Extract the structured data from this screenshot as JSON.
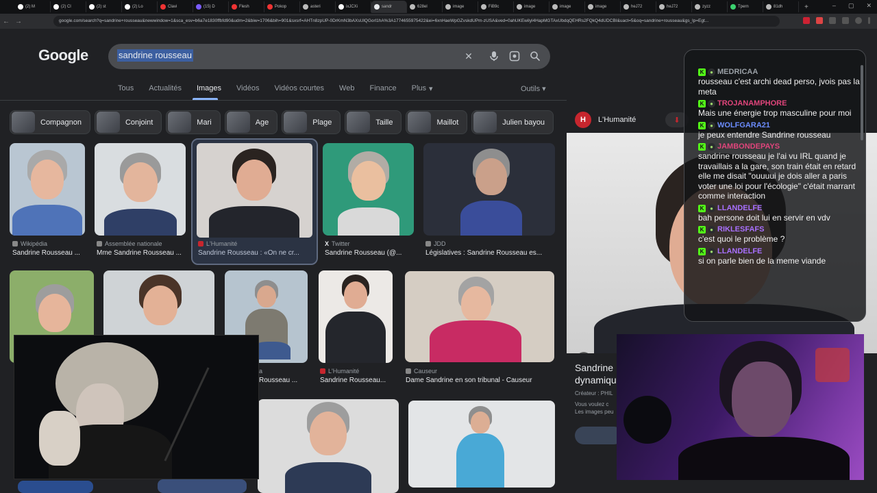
{
  "browser": {
    "tabs": [
      "(2) M",
      "(2) Cl",
      "(2) st",
      "(2) Lo",
      "Clavi",
      "(15) D",
      "Flesh",
      "Pokop",
      "asteri",
      "ixJCXi",
      "sandr",
      "628el",
      "image",
      "FiB9c",
      "image",
      "image",
      "image",
      "heJ72",
      "heJ72",
      "zyzz",
      "Tpern",
      "81dh"
    ],
    "active_tab_index": 10,
    "url": "google.com/search?q=sandrine+rousseau&newwindow=1&sca_esv=b6a7e1830ffbfd90&udm=2&biw=1706&bih=901&sxsrf=AHTn8zpUP-0DrKmN3bAXsUlQGorl1hA%3A1774655975422&ei=6xnHaeWpGZvskdUPm-zUSA&ved=0ahUKEwilyl4HapMGTAxUbdqQEHRs2FQkQ4dUDCBI&uact=5&oq=sandrine+rousseau&gs_lp=Egt..."
  },
  "google": {
    "logo": "Google",
    "query": "sandrine rousseau",
    "tabs": [
      "Tous",
      "Actualités",
      "Images",
      "Vidéos",
      "Vidéos courtes",
      "Web",
      "Finance",
      "Plus"
    ],
    "active_tab": "Images",
    "tools": "Outils"
  },
  "chips": [
    "Compagnon",
    "Conjoint",
    "Mari",
    "Age",
    "Plage",
    "Taille",
    "Maillot",
    "Julien bayou"
  ],
  "results": [
    {
      "source": "Wikipédia",
      "caption": "Sandrine Rousseau ..."
    },
    {
      "source": "Assemblée nationale",
      "caption": "Mme Sandrine Rousseau ..."
    },
    {
      "source": "L'Humanité",
      "caption": "Sandrine Rousseau : «On ne cr..."
    },
    {
      "source": "Twitter",
      "caption": "Sandrine Rousseau (@..."
    },
    {
      "source": "JDD",
      "caption": "Législatives : Sandrine Rousseau es..."
    },
    {
      "source": "a",
      "caption": "Rousseau ..."
    },
    {
      "source": "L'Humanité",
      "caption": "Sandrine Rousseau..."
    },
    {
      "source": "Causeur",
      "caption": "Dame Sandrine en son tribunal - Causeur"
    }
  ],
  "panel": {
    "source": "L'Humanité",
    "title_line1": "Sandrine R",
    "title_line2": "dynamiqu",
    "creator": "Créateur : PHIL",
    "note_line1": "Vous voulez c",
    "note_line2": "Les images peu"
  },
  "chat": [
    {
      "user": "MEDRICAA",
      "color": "#9aa0a6",
      "text": "rousseau c'est archi dead perso, jvois pas la meta"
    },
    {
      "user": "TROJANAMPHORE",
      "color": "#e0457b",
      "text": "Mais une énergie trop masculine pour moi"
    },
    {
      "user": "WOLFGARA21",
      "color": "#6b8cff",
      "text": "je peux entendre Sandrine rousseau"
    },
    {
      "user": "JAMBONDEPAYS",
      "color": "#e0457b",
      "text": "sandrine rousseau je l'ai vu IRL quand je travaillais a la gare, son train était en retard elle me disait \"ouuuui je dois aller a paris voter une loi pour l'écologie\" c'était marrant comme interaction"
    },
    {
      "user": "LLANDELFE",
      "color": "#a970ff",
      "text": "bah persone doit lui en servir en vdv"
    },
    {
      "user": "RIKLESFAFS",
      "color": "#a970ff",
      "text": "c'est quoi le problème ?"
    },
    {
      "user": "LLANDELFE",
      "color": "#a970ff",
      "text": "si on parle bien de la meme viande"
    }
  ],
  "colors": {
    "accent": "#8ab4f8",
    "selection": "#3c5fa0",
    "kick": "#53fc18",
    "humanite": "#c6262e"
  }
}
